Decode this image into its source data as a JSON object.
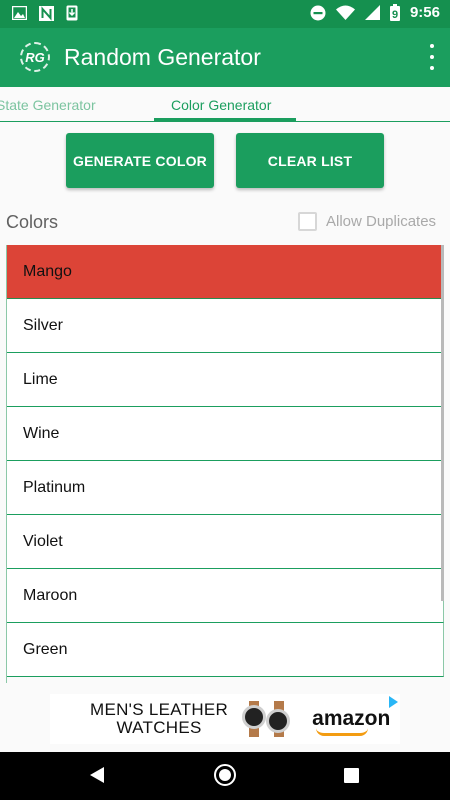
{
  "status_bar": {
    "time": "9:56",
    "battery_level": "9",
    "icons": [
      "image-icon",
      "n-notification-icon",
      "phone-download-icon",
      "do-not-disturb-icon",
      "wifi-icon",
      "signal-icon",
      "battery-icon"
    ]
  },
  "app_bar": {
    "logo_text": "RG",
    "title": "Random Generator",
    "menu_icon": "overflow-menu-icon"
  },
  "tabs": [
    {
      "label": "State Generator",
      "active": false
    },
    {
      "label": "Color Generator",
      "active": true
    }
  ],
  "buttons": {
    "generate": "GENERATE COLOR",
    "clear": "CLEAR LIST"
  },
  "colors_section": {
    "heading": "Colors",
    "allow_duplicates_label": "Allow Duplicates",
    "allow_duplicates_checked": false
  },
  "color_list": {
    "items": [
      "Mango",
      "Silver",
      "Lime",
      "Wine",
      "Platinum",
      "Violet",
      "Maroon",
      "Green"
    ],
    "selected_index": 0,
    "selected_color": "#dc4437"
  },
  "ad": {
    "headline_line1": "MEN'S LEATHER",
    "headline_line2": "WATCHES",
    "brand": "amazon"
  },
  "theme": {
    "primary": "#1b9e5e",
    "status_bar": "#15904f",
    "accent_red": "#dc4437"
  }
}
